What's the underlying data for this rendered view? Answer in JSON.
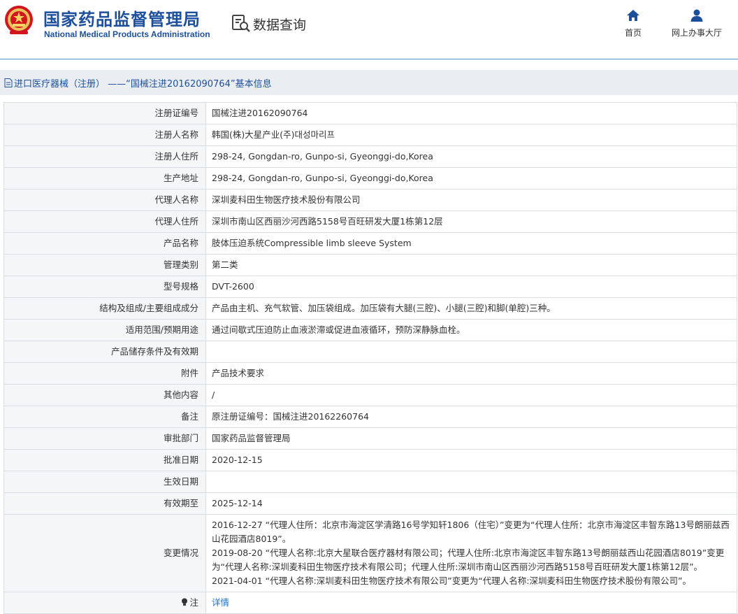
{
  "header": {
    "org_name_cn": "国家药品监督管理局",
    "org_name_en": "National Medical Products Administration",
    "query_title": "数据查询",
    "nav": [
      {
        "label": "首页",
        "icon": "home-icon"
      },
      {
        "label": "网上办事大厅",
        "icon": "user-icon"
      }
    ]
  },
  "breadcrumb": {
    "text": "进口医疗器械（注册） ——“国械注进20162090764”基本信息",
    "icon": "document-icon"
  },
  "rows": [
    {
      "label": "注册证编号",
      "value": "国械注进20162090764"
    },
    {
      "label": "注册人名称",
      "value": "韩国(株)大星产业(주)대성마리프"
    },
    {
      "label": "注册人住所",
      "value": "298-24, Gongdan-ro, Gunpo-si, Gyeonggi-do,Korea"
    },
    {
      "label": "生产地址",
      "value": "298-24, Gongdan-ro, Gunpo-si, Gyeonggi-do,Korea"
    },
    {
      "label": "代理人名称",
      "value": "深圳麦科田生物医疗技术股份有限公司"
    },
    {
      "label": "代理人住所",
      "value": "深圳市南山区西丽沙河西路5158号百旺研发大厦1栋第12层"
    },
    {
      "label": "产品名称",
      "value": "肢体压迫系统Compressible limb sleeve System"
    },
    {
      "label": "管理类别",
      "value": "第二类"
    },
    {
      "label": "型号规格",
      "value": "DVT-2600"
    },
    {
      "label": "结构及组成/主要组成成分",
      "value": "产品由主机、充气软管、加压袋组成。加压袋有大腿(三腔)、小腿(三腔)和脚(单腔)三种。"
    },
    {
      "label": "适用范围/预期用途",
      "value": "通过间歇式压迫防止血液淤滞或促进血液循环，预防深静脉血栓。"
    },
    {
      "label": "产品储存条件及有效期",
      "value": ""
    },
    {
      "label": "附件",
      "value": "产品技术要求"
    },
    {
      "label": "其他内容",
      "value": "/"
    },
    {
      "label": "备注",
      "value": "原注册证编号：国械注进20162260764"
    },
    {
      "label": "审批部门",
      "value": "国家药品监督管理局"
    },
    {
      "label": "批准日期",
      "value": "2020-12-15"
    },
    {
      "label": "生效日期",
      "value": ""
    },
    {
      "label": "有效期至",
      "value": "2025-12-14"
    }
  ],
  "change_history": {
    "label": "变更情况",
    "lines": [
      "2016-12-27 “代理人住所：北京市海淀区学清路16号学知轩1806（住宅）”变更为“代理人住所：北京市海淀区丰智东路13号朗丽兹西山花园酒店8019”。",
      "2019-08-20 “代理人名称:北京大星联合医疗器材有限公司；代理人住所:北京市海淀区丰智东路13号朗丽兹西山花园酒店8019”变更为“代理人名称:深圳麦科田生物医疗技术有限公司；代理人住所:深圳市南山区西丽沙河西路5158号百旺研发大厦1栋第12层”。",
      "2021-04-01 “代理人名称:深圳麦科田生物医疗技术有限公司”变更为“代理人名称:深圳麦科田生物医疗技术股份有限公司”。"
    ]
  },
  "note": {
    "label": "注",
    "link": "详情",
    "icon": "lightbulb-icon"
  },
  "colors": {
    "brand_blue": "#1c4f9c",
    "link_blue": "#1c6fc4",
    "label_bg": "#f4f6f8",
    "breadcrumb_bg": "#eaeef2",
    "border": "#d8dde3"
  }
}
